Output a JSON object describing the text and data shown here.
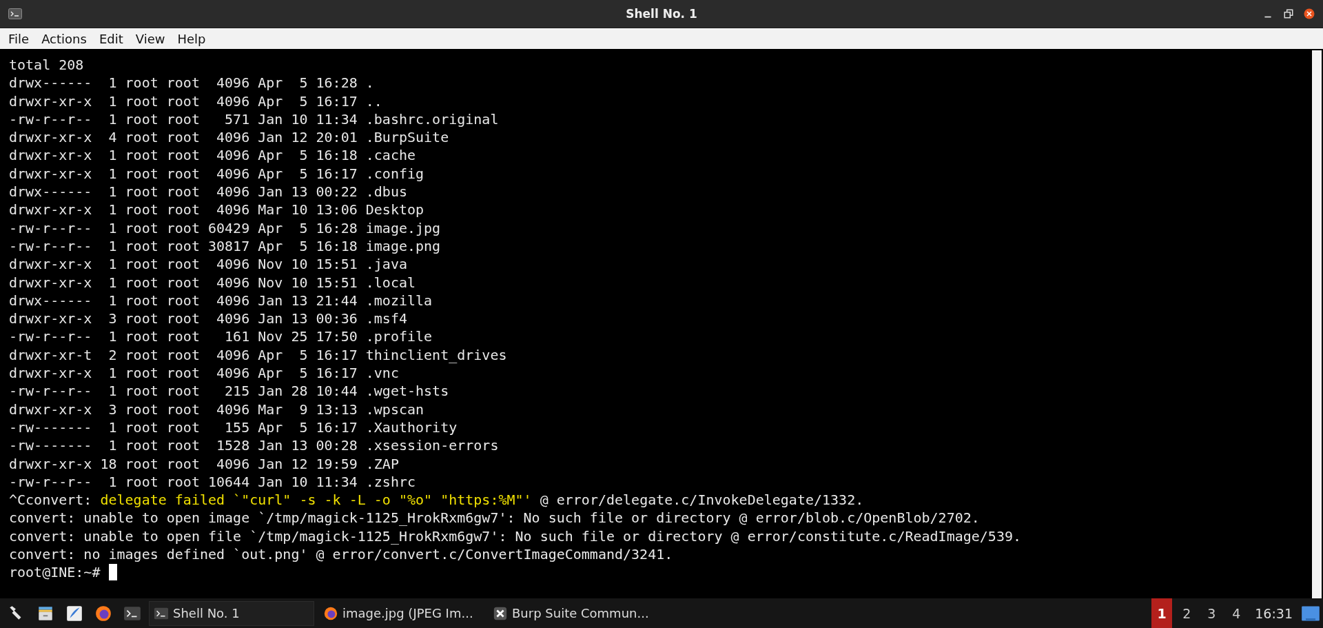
{
  "window": {
    "title": "Shell No. 1"
  },
  "menu": [
    "File",
    "Actions",
    "Edit",
    "View",
    "Help"
  ],
  "terminal": {
    "lines": [
      [
        {
          "text": "total 208",
          "highlight": false
        }
      ],
      [
        {
          "text": "drwx------  1 root root  4096 Apr  5 16:28 .",
          "highlight": false
        }
      ],
      [
        {
          "text": "drwxr-xr-x  1 root root  4096 Apr  5 16:17 ..",
          "highlight": false
        }
      ],
      [
        {
          "text": "-rw-r--r--  1 root root   571 Jan 10 11:34 .bashrc.original",
          "highlight": false
        }
      ],
      [
        {
          "text": "drwxr-xr-x  4 root root  4096 Jan 12 20:01 .BurpSuite",
          "highlight": false
        }
      ],
      [
        {
          "text": "drwxr-xr-x  1 root root  4096 Apr  5 16:18 .cache",
          "highlight": false
        }
      ],
      [
        {
          "text": "drwxr-xr-x  1 root root  4096 Apr  5 16:17 .config",
          "highlight": false
        }
      ],
      [
        {
          "text": "drwx------  1 root root  4096 Jan 13 00:22 .dbus",
          "highlight": false
        }
      ],
      [
        {
          "text": "drwxr-xr-x  1 root root  4096 Mar 10 13:06 Desktop",
          "highlight": false
        }
      ],
      [
        {
          "text": "-rw-r--r--  1 root root 60429 Apr  5 16:28 image.jpg",
          "highlight": false
        }
      ],
      [
        {
          "text": "-rw-r--r--  1 root root 30817 Apr  5 16:18 image.png",
          "highlight": false
        }
      ],
      [
        {
          "text": "drwxr-xr-x  1 root root  4096 Nov 10 15:51 .java",
          "highlight": false
        }
      ],
      [
        {
          "text": "drwxr-xr-x  1 root root  4096 Nov 10 15:51 .local",
          "highlight": false
        }
      ],
      [
        {
          "text": "drwx------  1 root root  4096 Jan 13 21:44 .mozilla",
          "highlight": false
        }
      ],
      [
        {
          "text": "drwxr-xr-x  3 root root  4096 Jan 13 00:36 .msf4",
          "highlight": false
        }
      ],
      [
        {
          "text": "-rw-r--r--  1 root root   161 Nov 25 17:50 .profile",
          "highlight": false
        }
      ],
      [
        {
          "text": "drwxr-xr-t  2 root root  4096 Apr  5 16:17 thinclient_drives",
          "highlight": false
        }
      ],
      [
        {
          "text": "drwxr-xr-x  1 root root  4096 Apr  5 16:17 .vnc",
          "highlight": false
        }
      ],
      [
        {
          "text": "-rw-r--r--  1 root root   215 Jan 28 10:44 .wget-hsts",
          "highlight": false
        }
      ],
      [
        {
          "text": "drwxr-xr-x  3 root root  4096 Mar  9 13:13 .wpscan",
          "highlight": false
        }
      ],
      [
        {
          "text": "-rw-------  1 root root   155 Apr  5 16:17 .Xauthority",
          "highlight": false
        }
      ],
      [
        {
          "text": "-rw-------  1 root root  1528 Jan 13 00:28 .xsession-errors",
          "highlight": false
        }
      ],
      [
        {
          "text": "drwxr-xr-x 18 root root  4096 Jan 12 19:59 .ZAP",
          "highlight": false
        }
      ],
      [
        {
          "text": "-rw-r--r--  1 root root 10644 Jan 10 11:34 .zshrc",
          "highlight": false
        }
      ],
      [
        {
          "text": "^Cconvert: ",
          "highlight": false
        },
        {
          "text": "delegate failed `\"curl\" -s -k -L -o \"%o\" \"https:%M\"'",
          "highlight": true
        },
        {
          "text": " @ error/delegate.c/InvokeDelegate/1332.",
          "highlight": false
        }
      ],
      [
        {
          "text": "convert: unable to open image `/tmp/magick-1125_HrokRxm6gw7': No such file or directory @ error/blob.c/OpenBlob/2702.",
          "highlight": false
        }
      ],
      [
        {
          "text": "convert: unable to open file `/tmp/magick-1125_HrokRxm6gw7': No such file or directory @ error/constitute.c/ReadImage/539.",
          "highlight": false
        }
      ],
      [
        {
          "text": "convert: no images defined `out.png' @ error/convert.c/ConvertImageCommand/3241.",
          "highlight": false
        }
      ]
    ],
    "prompt": "root@INE:~# "
  },
  "taskbar": {
    "tasks": [
      {
        "label": "Shell No. 1",
        "kind": "terminal",
        "selected": true
      },
      {
        "label": "image.jpg (JPEG Im...",
        "kind": "browser",
        "selected": false
      },
      {
        "label": "Burp Suite Commun...",
        "kind": "app",
        "selected": false
      }
    ],
    "workspaces": [
      {
        "label": "1",
        "selected": true
      },
      {
        "label": "2",
        "selected": false
      },
      {
        "label": "3",
        "selected": false
      },
      {
        "label": "4",
        "selected": false
      }
    ],
    "clock": "16:31"
  }
}
